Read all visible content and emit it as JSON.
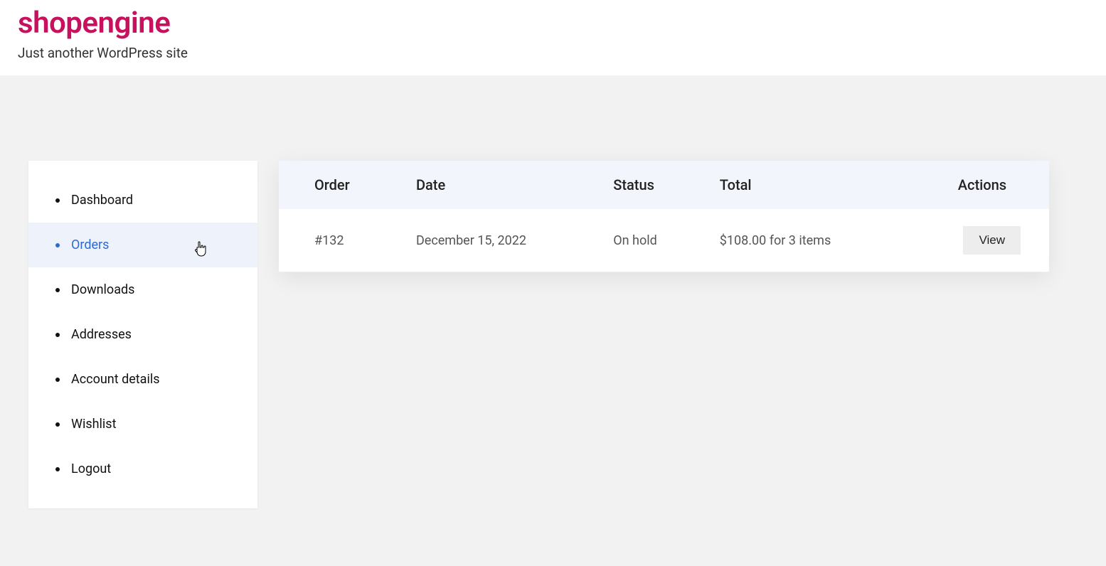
{
  "header": {
    "site_title": "shopengine",
    "tagline": "Just another WordPress site"
  },
  "sidebar": {
    "items": [
      {
        "label": "Dashboard",
        "active": false
      },
      {
        "label": "Orders",
        "active": true
      },
      {
        "label": "Downloads",
        "active": false
      },
      {
        "label": "Addresses",
        "active": false
      },
      {
        "label": "Account details",
        "active": false
      },
      {
        "label": "Wishlist",
        "active": false
      },
      {
        "label": "Logout",
        "active": false
      }
    ]
  },
  "orders_table": {
    "columns": {
      "order": "Order",
      "date": "Date",
      "status": "Status",
      "total": "Total",
      "actions": "Actions"
    },
    "rows": [
      {
        "order": "#132",
        "date": "December 15, 2022",
        "status": "On hold",
        "total": "$108.00 for 3 items",
        "action_label": "View"
      }
    ]
  }
}
